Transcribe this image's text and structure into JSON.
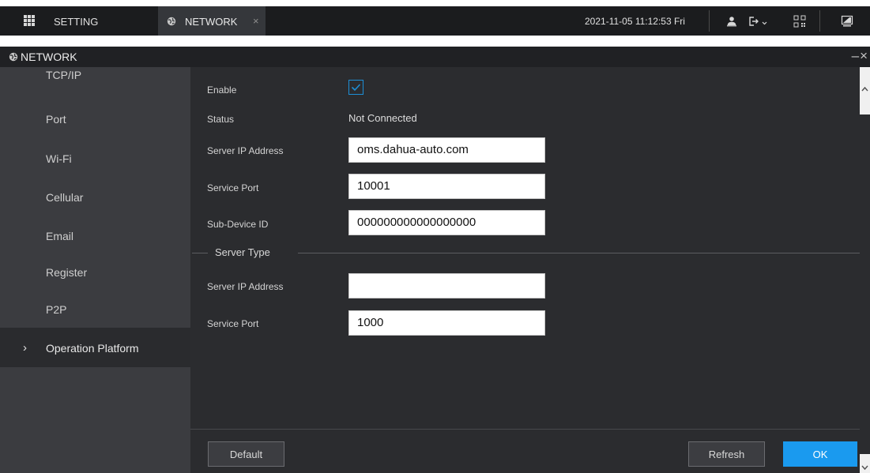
{
  "topbar": {
    "setting_tab": {
      "label": "SETTING",
      "icon": "grid-menu-icon"
    },
    "network_tab": {
      "label": "NETWORK",
      "icon": "globe-icon",
      "close": "×"
    },
    "datetime": "2021-11-05 11:12:53 Fri",
    "icons": [
      "user-icon",
      "logout-icon",
      "qr-code-icon",
      "monitor-icon"
    ]
  },
  "window": {
    "title": "NETWORK",
    "controls": "–×"
  },
  "sidebar": {
    "items": [
      {
        "label": "TCP/IP"
      },
      {
        "label": "Port"
      },
      {
        "label": "Wi-Fi"
      },
      {
        "label": "Cellular"
      },
      {
        "label": "Email"
      },
      {
        "label": "Register"
      },
      {
        "label": "P2P"
      },
      {
        "label": "Operation Platform",
        "active": true,
        "marker": "›"
      }
    ]
  },
  "form": {
    "enable": {
      "label": "Enable",
      "checked": true
    },
    "status": {
      "label": "Status",
      "value": "Not Connected"
    },
    "server_ip": {
      "label": "Server IP Address",
      "value": "oms.dahua-auto.com"
    },
    "service_port": {
      "label": "Service Port",
      "value": "10001"
    },
    "sub_device_id": {
      "label": "Sub-Device ID",
      "value": "000000000000000000"
    },
    "server_type_group": "Server Type",
    "server_ip_2": {
      "label": "Server IP Address",
      "value": ""
    },
    "service_port_2": {
      "label": "Service Port",
      "value": "1000"
    }
  },
  "buttons": {
    "default": "Default",
    "refresh": "Refresh",
    "ok": "OK"
  },
  "colors": {
    "accent": "#1a9aef",
    "panel": "#2b2c2f",
    "sidebar": "#3b3c40",
    "topbar": "#1b1c1e"
  }
}
